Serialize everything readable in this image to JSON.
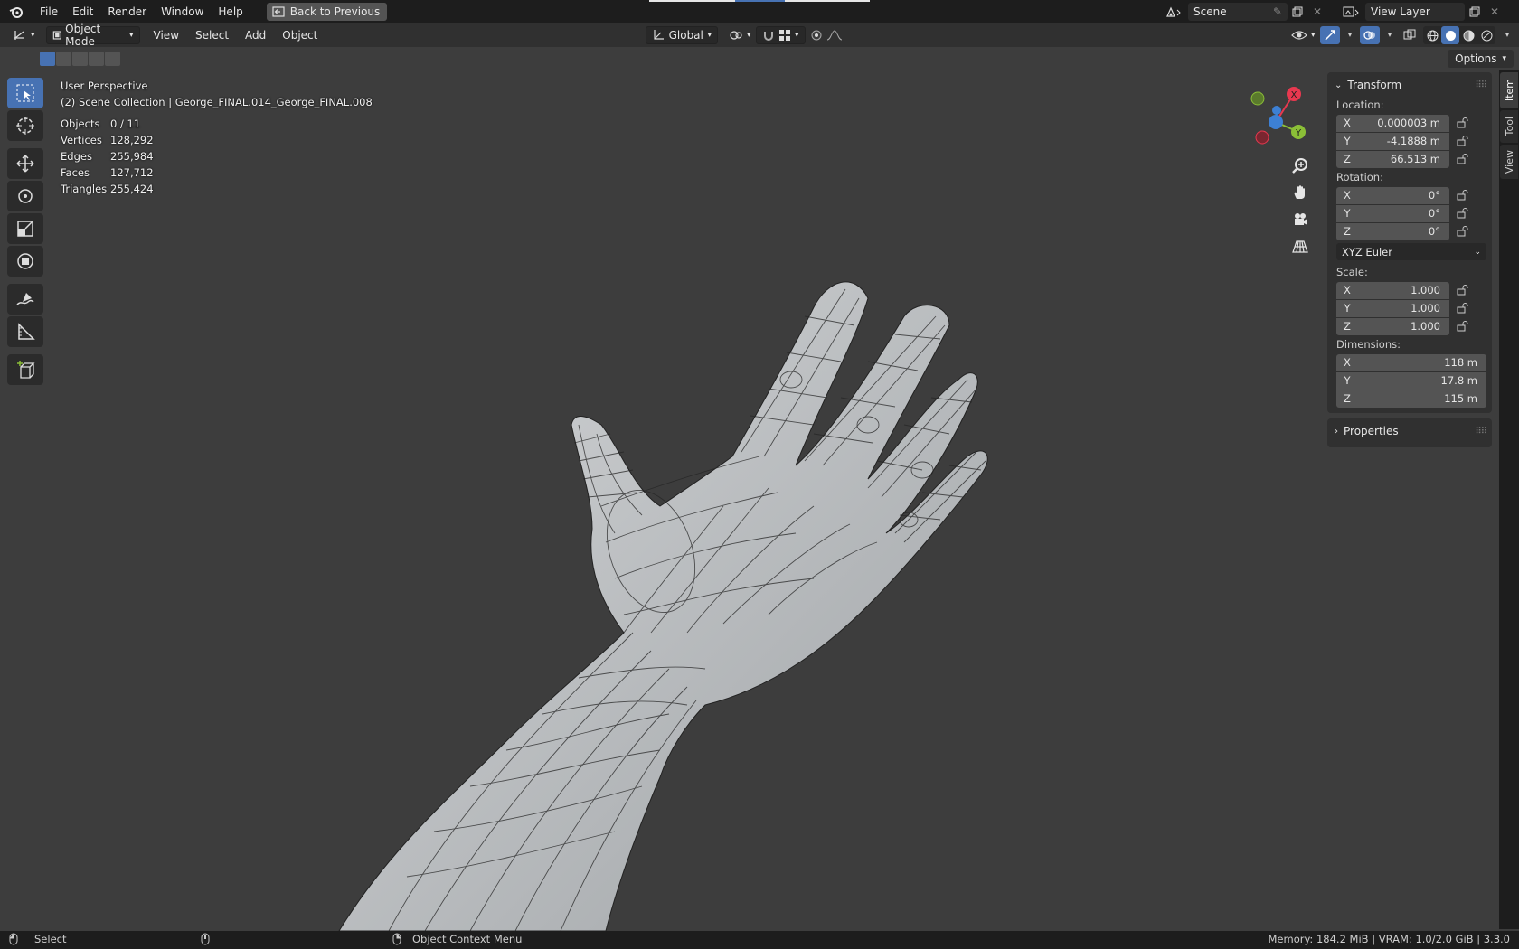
{
  "topbar": {
    "menus": [
      "File",
      "Edit",
      "Render",
      "Window",
      "Help"
    ],
    "back_button": "Back to Previous",
    "scene_label": "Scene",
    "view_layer_label": "View Layer"
  },
  "header": {
    "mode": "Object Mode",
    "menus": [
      "View",
      "Select",
      "Add",
      "Object"
    ],
    "orientation": "Global"
  },
  "subheader": {
    "options": "Options"
  },
  "viewport": {
    "perspective": "User Perspective",
    "collection": "(2) Scene Collection | George_FINAL.014_George_FINAL.008",
    "stats": [
      {
        "key": "Objects",
        "value": "0 / 11"
      },
      {
        "key": "Vertices",
        "value": "128,292"
      },
      {
        "key": "Edges",
        "value": "255,984"
      },
      {
        "key": "Faces",
        "value": "127,712"
      },
      {
        "key": "Triangles",
        "value": "255,424"
      }
    ],
    "gizmo": {
      "x": "X",
      "y": "Y",
      "z": "Z"
    }
  },
  "sidebar": {
    "transform_title": "Transform",
    "location_label": "Location:",
    "location": [
      {
        "axis": "X",
        "value": "0.000003 m"
      },
      {
        "axis": "Y",
        "value": "-4.1888 m"
      },
      {
        "axis": "Z",
        "value": "66.513 m"
      }
    ],
    "rotation_label": "Rotation:",
    "rotation": [
      {
        "axis": "X",
        "value": "0°"
      },
      {
        "axis": "Y",
        "value": "0°"
      },
      {
        "axis": "Z",
        "value": "0°"
      }
    ],
    "rotation_mode": "XYZ Euler",
    "scale_label": "Scale:",
    "scale": [
      {
        "axis": "X",
        "value": "1.000"
      },
      {
        "axis": "Y",
        "value": "1.000"
      },
      {
        "axis": "Z",
        "value": "1.000"
      }
    ],
    "dimensions_label": "Dimensions:",
    "dimensions": [
      {
        "axis": "X",
        "value": "118 m"
      },
      {
        "axis": "Y",
        "value": "17.8 m"
      },
      {
        "axis": "Z",
        "value": "115 m"
      }
    ],
    "properties_title": "Properties",
    "tabs": [
      "Item",
      "Tool",
      "View"
    ]
  },
  "statusbar": {
    "select": "Select",
    "context_menu": "Object Context Menu",
    "info": "Memory: 184.2 MiB | VRAM: 1.0/2.0 GiB | 3.3.0"
  },
  "colors": {
    "accent": "#4772b3",
    "axis_x": "#e8384f",
    "axis_y": "#8bbf37",
    "axis_z": "#3d80d4"
  }
}
